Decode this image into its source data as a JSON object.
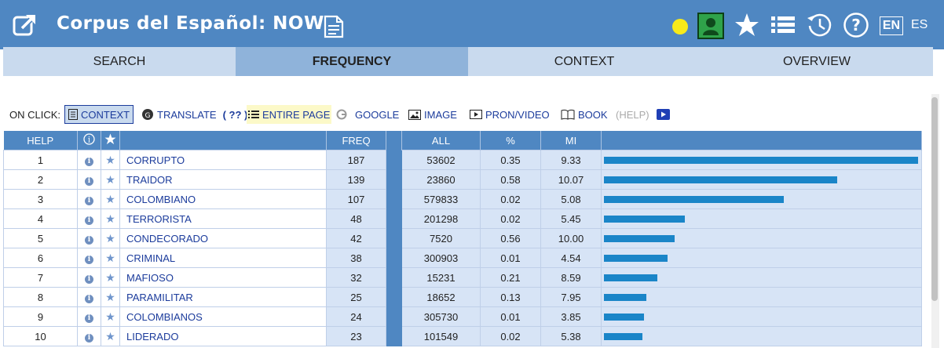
{
  "header": {
    "title": "Corpus del Español: NOW",
    "lang_en": "EN",
    "lang_es": "ES",
    "icons": [
      "external-link-icon",
      "document-icon",
      "status-dot-icon",
      "user-icon",
      "star-icon",
      "list-icon",
      "history-icon",
      "help-icon"
    ]
  },
  "tabs": [
    "SEARCH",
    "FREQUENCY",
    "CONTEXT",
    "OVERVIEW"
  ],
  "active_tab": "FREQUENCY",
  "onclick": {
    "label": "ON CLICK:",
    "context": "CONTEXT",
    "translate": "TRANSLATE",
    "translate_q": "( ?? )",
    "entire_page": "ENTIRE PAGE",
    "google": "GOOGLE",
    "image": "IMAGE",
    "pron_video": "PRON/VIDEO",
    "book": "BOOK",
    "help": "(HELP)"
  },
  "table": {
    "headers": {
      "help": "HELP",
      "freq": "FREQ",
      "all": "ALL",
      "pct": "%",
      "mi": "MI"
    },
    "rows": [
      {
        "n": "1",
        "word": "CORRUPTO",
        "freq": "187",
        "all": "53602",
        "pct": "0.35",
        "mi": "9.33",
        "bar": 1.0
      },
      {
        "n": "2",
        "word": "TRAIDOR",
        "freq": "139",
        "all": "23860",
        "pct": "0.58",
        "mi": "10.07",
        "bar": 0.743
      },
      {
        "n": "3",
        "word": "COLOMBIANO",
        "freq": "107",
        "all": "579833",
        "pct": "0.02",
        "mi": "5.08",
        "bar": 0.572
      },
      {
        "n": "4",
        "word": "TERRORISTA",
        "freq": "48",
        "all": "201298",
        "pct": "0.02",
        "mi": "5.45",
        "bar": 0.257
      },
      {
        "n": "5",
        "word": "CONDECORADO",
        "freq": "42",
        "all": "7520",
        "pct": "0.56",
        "mi": "10.00",
        "bar": 0.225
      },
      {
        "n": "6",
        "word": "CRIMINAL",
        "freq": "38",
        "all": "300903",
        "pct": "0.01",
        "mi": "4.54",
        "bar": 0.203
      },
      {
        "n": "7",
        "word": "MAFIOSO",
        "freq": "32",
        "all": "15231",
        "pct": "0.21",
        "mi": "8.59",
        "bar": 0.171
      },
      {
        "n": "8",
        "word": "PARAMILITAR",
        "freq": "25",
        "all": "18652",
        "pct": "0.13",
        "mi": "7.95",
        "bar": 0.134
      },
      {
        "n": "9",
        "word": "COLOMBIANOS",
        "freq": "24",
        "all": "305730",
        "pct": "0.01",
        "mi": "3.85",
        "bar": 0.128
      },
      {
        "n": "10",
        "word": "LIDERADO",
        "freq": "23",
        "all": "101549",
        "pct": "0.02",
        "mi": "5.38",
        "bar": 0.123
      }
    ]
  }
}
